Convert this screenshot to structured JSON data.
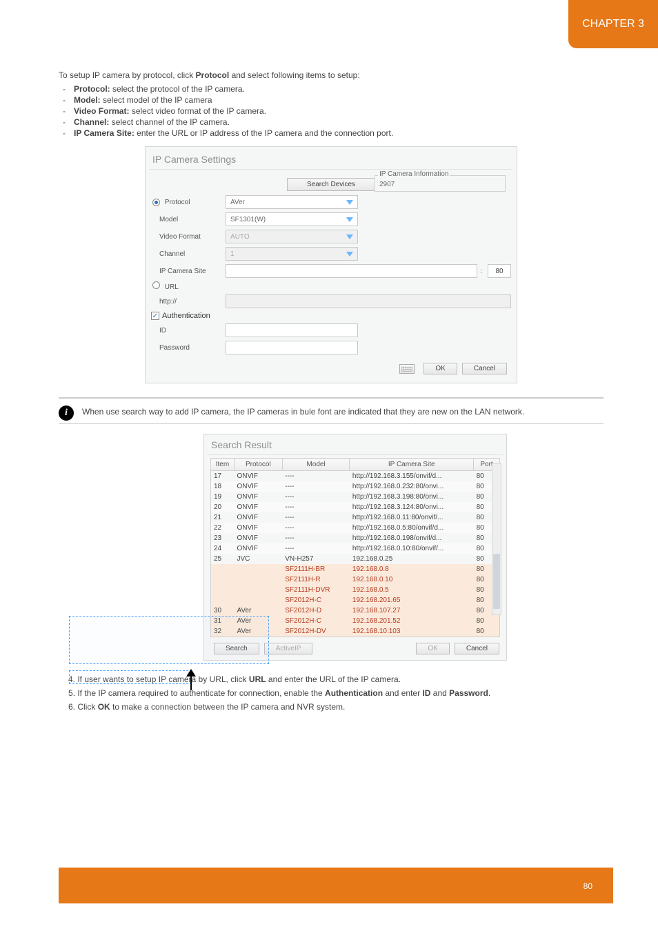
{
  "chapter": {
    "label": "CHAPTER 3"
  },
  "intro": {
    "line1": "To setup IP camera by protocol, click",
    "line1_b": "Protocol",
    "line1_c": "and select following items to setup:",
    "bullets": {
      "proto_b": "Protocol:",
      "proto_t": "select the protocol of the IP camera.",
      "model_b": "Model:",
      "model_t": "select model of the IP camera",
      "vf_b": "Video Format:",
      "vf_t": "select video format of the IP camera.",
      "ch_b": "Channel:",
      "ch_t": "select channel of the IP camera.",
      "site_b": "IP Camera Site:",
      "site_t": "enter the URL or IP address of the IP camera and the connection port."
    }
  },
  "dlg1": {
    "title": "IP Camera Settings",
    "search_btn": "Search Devices",
    "info_title": "IP Camera Information",
    "info_val": "2907",
    "labels": {
      "protocol": "Protocol",
      "model": "Model",
      "vformat": "Video Format",
      "channel": "Channel",
      "site": "IP Camera Site",
      "url": "URL",
      "http": "http://",
      "auth": "Authentication",
      "id": "ID",
      "pw": "Password"
    },
    "vals": {
      "protocol": "AVer",
      "model": "SF1301(W)",
      "vformat": "AUTO",
      "channel": "1",
      "port": "80"
    },
    "ok": "OK",
    "cancel": "Cancel"
  },
  "note": "When use search way to add IP camera, the IP cameras in bule font are indicated that they are new on the LAN network.",
  "dlg2": {
    "title": "Search Result",
    "headers": {
      "item": "Item",
      "protocol": "Protocol",
      "model": "Model",
      "site": "IP Camera Site",
      "port": "Port"
    },
    "rows": [
      {
        "i": "17",
        "p": "ONVIF",
        "m": "----",
        "s": "http://192.168.3.155/onvif/d...",
        "port": "80",
        "sel": false
      },
      {
        "i": "18",
        "p": "ONVIF",
        "m": "----",
        "s": "http://192.168.0.232:80/onvi...",
        "port": "80",
        "sel": false
      },
      {
        "i": "19",
        "p": "ONVIF",
        "m": "----",
        "s": "http://192.168.3.198:80/onvi...",
        "port": "80",
        "sel": false
      },
      {
        "i": "20",
        "p": "ONVIF",
        "m": "----",
        "s": "http://192.168.3.124:80/onvi...",
        "port": "80",
        "sel": false
      },
      {
        "i": "21",
        "p": "ONVIF",
        "m": "----",
        "s": "http://192.168.0.11:80/onvif/...",
        "port": "80",
        "sel": false
      },
      {
        "i": "22",
        "p": "ONVIF",
        "m": "----",
        "s": "http://192.168.0.5:80/onvif/d...",
        "port": "80",
        "sel": false
      },
      {
        "i": "23",
        "p": "ONVIF",
        "m": "----",
        "s": "http://192.168.0.198/onvif/d...",
        "port": "80",
        "sel": false
      },
      {
        "i": "24",
        "p": "ONVIF",
        "m": "----",
        "s": "http://192.168.0.10:80/onvif/...",
        "port": "80",
        "sel": false
      },
      {
        "i": "25",
        "p": "JVC",
        "m": "VN-H257",
        "s": "192.168.0.25",
        "port": "80",
        "sel": false
      },
      {
        "i": "",
        "p": "",
        "m": "SF2111H-BR",
        "s": "192.168.0.8",
        "port": "80",
        "sel": true
      },
      {
        "i": "",
        "p": "",
        "m": "SF2111H-R",
        "s": "192.168.0.10",
        "port": "80",
        "sel": true
      },
      {
        "i": "",
        "p": "",
        "m": "SF2111H-DVR",
        "s": "192.168.0.5",
        "port": "80",
        "sel": true
      },
      {
        "i": "",
        "p": "",
        "m": "SF2012H-C",
        "s": "192.168.201.65",
        "port": "80",
        "sel": true
      },
      {
        "i": "30",
        "p": "AVer",
        "m": "SF2012H-D",
        "s": "192.168.107.27",
        "port": "80",
        "sel": true
      },
      {
        "i": "31",
        "p": "AVer",
        "m": "SF2012H-C",
        "s": "192.168.201.52",
        "port": "80",
        "sel": true
      },
      {
        "i": "32",
        "p": "AVer",
        "m": "SF2012H-DV",
        "s": "192.168.10.103",
        "port": "80",
        "sel": true
      }
    ],
    "search": "Search",
    "activeip": "ActiveIP",
    "ok": "OK",
    "cancel": "Cancel"
  },
  "steps": {
    "s4a": "4. If user wants to setup IP camera by URL, click",
    "s4b": "URL",
    "s4c": "and enter the URL of the IP camera.",
    "s5a": "5. If the IP camera required to authenticate for connection, enable the",
    "s5b": "Authentication",
    "s5c": "and enter",
    "s5d": "ID",
    "s5e": "and",
    "s5f": "Password",
    "s5g": ".",
    "s6a": "6. Click",
    "s6b": "OK",
    "s6c": "to make a connection between the IP camera and NVR system."
  },
  "page": "80"
}
